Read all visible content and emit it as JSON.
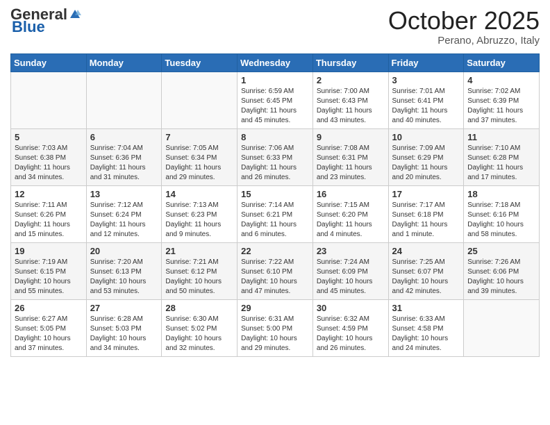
{
  "header": {
    "logo_general": "General",
    "logo_blue": "Blue",
    "month_title": "October 2025",
    "location": "Perano, Abruzzo, Italy"
  },
  "days_of_week": [
    "Sunday",
    "Monday",
    "Tuesday",
    "Wednesday",
    "Thursday",
    "Friday",
    "Saturday"
  ],
  "weeks": [
    [
      {
        "day": "",
        "info": ""
      },
      {
        "day": "",
        "info": ""
      },
      {
        "day": "",
        "info": ""
      },
      {
        "day": "1",
        "info": "Sunrise: 6:59 AM\nSunset: 6:45 PM\nDaylight: 11 hours and 45 minutes."
      },
      {
        "day": "2",
        "info": "Sunrise: 7:00 AM\nSunset: 6:43 PM\nDaylight: 11 hours and 43 minutes."
      },
      {
        "day": "3",
        "info": "Sunrise: 7:01 AM\nSunset: 6:41 PM\nDaylight: 11 hours and 40 minutes."
      },
      {
        "day": "4",
        "info": "Sunrise: 7:02 AM\nSunset: 6:39 PM\nDaylight: 11 hours and 37 minutes."
      }
    ],
    [
      {
        "day": "5",
        "info": "Sunrise: 7:03 AM\nSunset: 6:38 PM\nDaylight: 11 hours and 34 minutes."
      },
      {
        "day": "6",
        "info": "Sunrise: 7:04 AM\nSunset: 6:36 PM\nDaylight: 11 hours and 31 minutes."
      },
      {
        "day": "7",
        "info": "Sunrise: 7:05 AM\nSunset: 6:34 PM\nDaylight: 11 hours and 29 minutes."
      },
      {
        "day": "8",
        "info": "Sunrise: 7:06 AM\nSunset: 6:33 PM\nDaylight: 11 hours and 26 minutes."
      },
      {
        "day": "9",
        "info": "Sunrise: 7:08 AM\nSunset: 6:31 PM\nDaylight: 11 hours and 23 minutes."
      },
      {
        "day": "10",
        "info": "Sunrise: 7:09 AM\nSunset: 6:29 PM\nDaylight: 11 hours and 20 minutes."
      },
      {
        "day": "11",
        "info": "Sunrise: 7:10 AM\nSunset: 6:28 PM\nDaylight: 11 hours and 17 minutes."
      }
    ],
    [
      {
        "day": "12",
        "info": "Sunrise: 7:11 AM\nSunset: 6:26 PM\nDaylight: 11 hours and 15 minutes."
      },
      {
        "day": "13",
        "info": "Sunrise: 7:12 AM\nSunset: 6:24 PM\nDaylight: 11 hours and 12 minutes."
      },
      {
        "day": "14",
        "info": "Sunrise: 7:13 AM\nSunset: 6:23 PM\nDaylight: 11 hours and 9 minutes."
      },
      {
        "day": "15",
        "info": "Sunrise: 7:14 AM\nSunset: 6:21 PM\nDaylight: 11 hours and 6 minutes."
      },
      {
        "day": "16",
        "info": "Sunrise: 7:15 AM\nSunset: 6:20 PM\nDaylight: 11 hours and 4 minutes."
      },
      {
        "day": "17",
        "info": "Sunrise: 7:17 AM\nSunset: 6:18 PM\nDaylight: 11 hours and 1 minute."
      },
      {
        "day": "18",
        "info": "Sunrise: 7:18 AM\nSunset: 6:16 PM\nDaylight: 10 hours and 58 minutes."
      }
    ],
    [
      {
        "day": "19",
        "info": "Sunrise: 7:19 AM\nSunset: 6:15 PM\nDaylight: 10 hours and 55 minutes."
      },
      {
        "day": "20",
        "info": "Sunrise: 7:20 AM\nSunset: 6:13 PM\nDaylight: 10 hours and 53 minutes."
      },
      {
        "day": "21",
        "info": "Sunrise: 7:21 AM\nSunset: 6:12 PM\nDaylight: 10 hours and 50 minutes."
      },
      {
        "day": "22",
        "info": "Sunrise: 7:22 AM\nSunset: 6:10 PM\nDaylight: 10 hours and 47 minutes."
      },
      {
        "day": "23",
        "info": "Sunrise: 7:24 AM\nSunset: 6:09 PM\nDaylight: 10 hours and 45 minutes."
      },
      {
        "day": "24",
        "info": "Sunrise: 7:25 AM\nSunset: 6:07 PM\nDaylight: 10 hours and 42 minutes."
      },
      {
        "day": "25",
        "info": "Sunrise: 7:26 AM\nSunset: 6:06 PM\nDaylight: 10 hours and 39 minutes."
      }
    ],
    [
      {
        "day": "26",
        "info": "Sunrise: 6:27 AM\nSunset: 5:05 PM\nDaylight: 10 hours and 37 minutes."
      },
      {
        "day": "27",
        "info": "Sunrise: 6:28 AM\nSunset: 5:03 PM\nDaylight: 10 hours and 34 minutes."
      },
      {
        "day": "28",
        "info": "Sunrise: 6:30 AM\nSunset: 5:02 PM\nDaylight: 10 hours and 32 minutes."
      },
      {
        "day": "29",
        "info": "Sunrise: 6:31 AM\nSunset: 5:00 PM\nDaylight: 10 hours and 29 minutes."
      },
      {
        "day": "30",
        "info": "Sunrise: 6:32 AM\nSunset: 4:59 PM\nDaylight: 10 hours and 26 minutes."
      },
      {
        "day": "31",
        "info": "Sunrise: 6:33 AM\nSunset: 4:58 PM\nDaylight: 10 hours and 24 minutes."
      },
      {
        "day": "",
        "info": ""
      }
    ]
  ]
}
